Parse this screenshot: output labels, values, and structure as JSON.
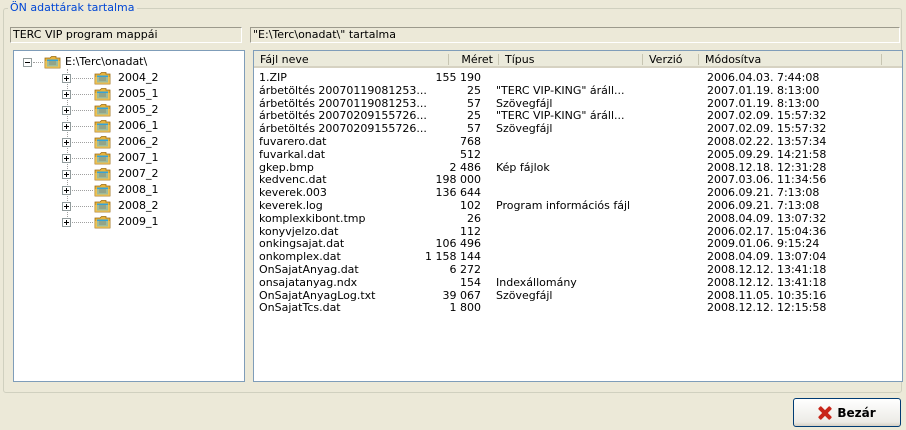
{
  "groupbox": {
    "title": "ÖN adattárak tartalma"
  },
  "left_header": "TERC VIP program mappái",
  "right_header": "\"E:\\Terc\\onadat\\\" tartalma",
  "tree": {
    "root": "E:\\Terc\\onadat\\",
    "children": [
      "2004_2",
      "2005_1",
      "2005_2",
      "2006_1",
      "2006_2",
      "2007_1",
      "2007_2",
      "2008_1",
      "2008_2",
      "2009_1"
    ]
  },
  "columns": {
    "name": "Fájl neve",
    "size": "Méret",
    "type": "Típus",
    "version": "Verzió",
    "modified": "Módosítva"
  },
  "files": [
    {
      "name": "1.ZIP",
      "size": "155 190",
      "type": "",
      "modified": "2006.04.03. 7:44:08"
    },
    {
      "name": "árbetöltés 20070119081253...",
      "size": "25",
      "type": "\"TERC VIP-KING\" áráll...",
      "modified": "2007.01.19. 8:13:00"
    },
    {
      "name": "árbetöltés 20070119081253...",
      "size": "57",
      "type": "Szövegfájl",
      "modified": "2007.01.19. 8:13:00"
    },
    {
      "name": "árbetöltés 20070209155726...",
      "size": "25",
      "type": "\"TERC VIP-KING\" áráll...",
      "modified": "2007.02.09. 15:57:32"
    },
    {
      "name": "árbetöltés 20070209155726...",
      "size": "57",
      "type": "Szövegfájl",
      "modified": "2007.02.09. 15:57:32"
    },
    {
      "name": "fuvarero.dat",
      "size": "768",
      "type": "",
      "modified": "2008.02.22. 13:57:34"
    },
    {
      "name": "fuvarkal.dat",
      "size": "512",
      "type": "",
      "modified": "2005.09.29. 14:21:58"
    },
    {
      "name": "gkep.bmp",
      "size": "2 486",
      "type": "Kép fájlok",
      "modified": "2008.12.18. 12:31:28"
    },
    {
      "name": "kedvenc.dat",
      "size": "198 000",
      "type": "",
      "modified": "2007.03.06. 11:34:56"
    },
    {
      "name": "keverek.003",
      "size": "136 644",
      "type": "",
      "modified": "2006.09.21. 7:13:08"
    },
    {
      "name": "keverek.log",
      "size": "102",
      "type": "Program információs fájl",
      "modified": "2006.09.21. 7:13:08"
    },
    {
      "name": "komplexkibont.tmp",
      "size": "26",
      "type": "",
      "modified": "2008.04.09. 13:07:32"
    },
    {
      "name": "konyvjelzo.dat",
      "size": "112",
      "type": "",
      "modified": "2006.02.17. 15:04:36"
    },
    {
      "name": "onkingsajat.dat",
      "size": "106 496",
      "type": "",
      "modified": "2009.01.06. 9:15:24"
    },
    {
      "name": "onkomplex.dat",
      "size": "1 158 144",
      "type": "",
      "modified": "2008.04.09. 13:07:04"
    },
    {
      "name": "OnSajatAnyag.dat",
      "size": "6 272",
      "type": "",
      "modified": "2008.12.12. 13:41:18"
    },
    {
      "name": "onsajatanyag.ndx",
      "size": "154",
      "type": "Indexállomány",
      "modified": "2008.12.12. 13:41:18"
    },
    {
      "name": "OnSajatAnyagLog.txt",
      "size": "39 067",
      "type": "Szövegfájl",
      "modified": "2008.11.05. 10:35:16"
    },
    {
      "name": "OnSajatTcs.dat",
      "size": "1 800",
      "type": "",
      "modified": "2008.12.12. 12:15:58"
    }
  ],
  "close_button": {
    "label": "Bezár",
    "icon": "close-x-icon",
    "icon_color": "#c8261a"
  },
  "colors": {
    "group_title": "#0046d5",
    "background": "#ece9d8",
    "panel_border": "#7f9db9"
  }
}
